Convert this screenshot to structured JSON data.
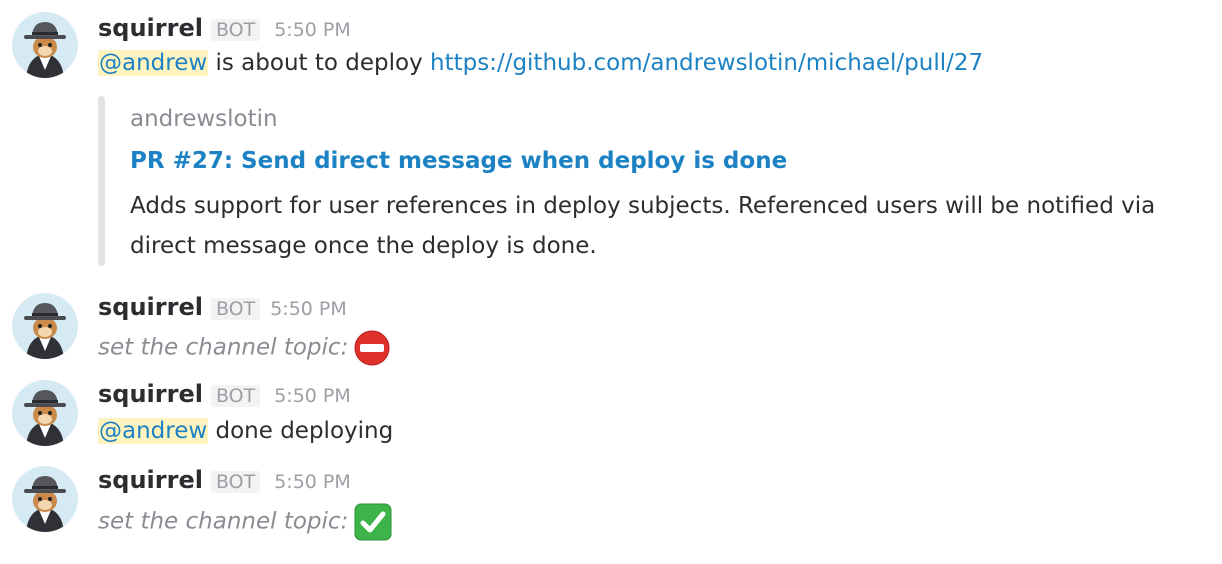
{
  "messages": [
    {
      "username": "squirrel",
      "badge": "BOT",
      "time": "5:50 PM",
      "mention": "@andrew",
      "text": " is about to deploy ",
      "link": "https://github.com/andrewslotin/michael/pull/27",
      "attachment": {
        "author": "andrewslotin",
        "title": "PR #27: Send direct message when deploy is done",
        "text": "Adds support for user references in deploy subjects. Referenced users will be notified via direct message once the deploy is done."
      }
    },
    {
      "username": "squirrel",
      "badge": "BOT",
      "time": "5:50 PM",
      "topic_text": "set the channel topic:",
      "topic_emoji": "no-entry-icon"
    },
    {
      "username": "squirrel",
      "badge": "BOT",
      "time": "5:50 PM",
      "mention": "@andrew",
      "text": " done deploying"
    },
    {
      "username": "squirrel",
      "badge": "BOT",
      "time": "5:50 PM",
      "topic_text": "set the channel topic:",
      "topic_emoji": "check-mark-icon"
    }
  ],
  "colors": {
    "link": "#1d82c3",
    "mention_bg": "#fff4c0",
    "no_entry": "#e0302b",
    "check": "#3cb44a"
  }
}
